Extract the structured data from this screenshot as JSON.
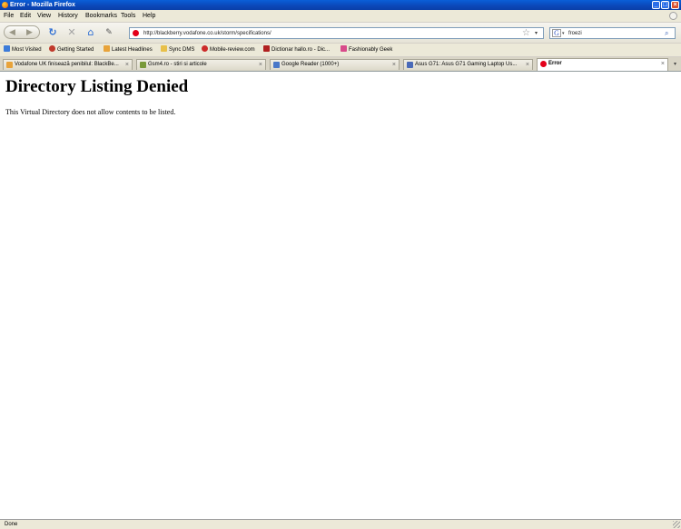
{
  "window": {
    "title": "Error - Mozilla Firefox",
    "controls": {
      "minimize": "_",
      "maximize": "□",
      "close": "×"
    }
  },
  "menu": [
    "File",
    "Edit",
    "View",
    "History",
    "Bookmarks",
    "Tools",
    "Help"
  ],
  "navigation": {
    "back_glyph": "◀",
    "forward_glyph": "▶",
    "reload_glyph": "↻",
    "stop_glyph": "✕",
    "home_glyph": "⌂",
    "edit_glyph": "✎",
    "url": "http://blackberry.vodafone.co.uk/storm/specifications/",
    "star_glyph": "☆",
    "dropdown_glyph": "▾",
    "search_engine_glyph": "G",
    "search_value": "froezi",
    "search_glyph": "⌕"
  },
  "bookmarks": [
    {
      "label": "Most Visited",
      "icon": "star-icon",
      "color": "#3c7bd9"
    },
    {
      "label": "Getting Started",
      "icon": "firefox-icon",
      "color": "#c0392b"
    },
    {
      "label": "Latest Headlines",
      "icon": "rss-icon",
      "color": "#e8a33a"
    },
    {
      "label": "Sync DMS",
      "icon": "folder-icon",
      "color": "#e8c04a"
    },
    {
      "label": "Mobile-review.com",
      "icon": "mr-icon",
      "color": "#cc2a2a"
    },
    {
      "label": "Dictionar hallo.ro - Dic...",
      "icon": "dictionary-icon",
      "color": "#b02020"
    },
    {
      "label": "Fashionably Geek",
      "icon": "geek-icon",
      "color": "#d84a8a"
    }
  ],
  "tabs": [
    {
      "label": "Vodafone UK finisează penibilul: BlackBe...",
      "icon": "vodafone-blog-icon",
      "color": "#e8a33a",
      "active": false
    },
    {
      "label": "Gsm4.ro - stiri si articole",
      "icon": "gsm4-icon",
      "color": "#7a9a3a",
      "active": false
    },
    {
      "label": "Google Reader (1000+)",
      "icon": "google-reader-icon",
      "color": "#4a78c8",
      "active": false
    },
    {
      "label": "Asus G71: Asus G71 Gaming Laptop Us...",
      "icon": "asus-icon",
      "color": "#4a6ab8",
      "active": false
    },
    {
      "label": "Error",
      "icon": "vodafone-icon",
      "color": "#e3001b",
      "active": true
    }
  ],
  "tab_close_glyph": "×",
  "tab_list_glyph": "▾",
  "content": {
    "heading": "Directory Listing Denied",
    "body": "This Virtual Directory does not allow contents to be listed."
  },
  "status": "Done"
}
